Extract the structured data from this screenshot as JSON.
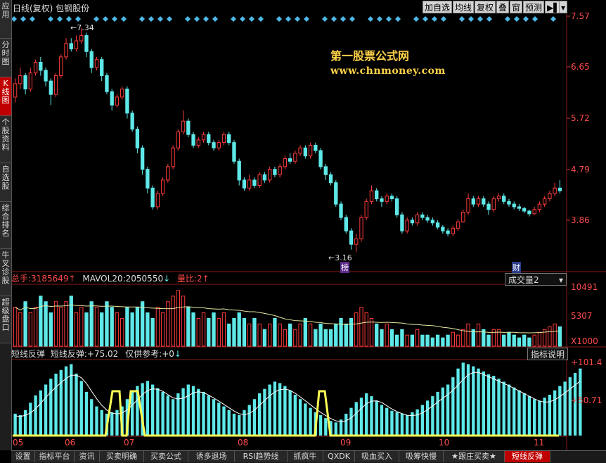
{
  "header": {
    "title": "日线(复权)  包钢股份",
    "toolbar": [
      "加自选",
      "均线",
      "复权",
      "叠",
      "窗",
      "预测",
      "▶▌",
      "▾"
    ]
  },
  "sidebar": {
    "items": [
      {
        "label": "应用",
        "active": false
      },
      {
        "label": "分时图",
        "active": false
      },
      {
        "label": "K线图",
        "active": true
      },
      {
        "label": "个股资料",
        "active": false
      },
      {
        "label": "自选股",
        "active": false
      },
      {
        "label": "综合排名",
        "active": false
      },
      {
        "label": "牛叉诊股",
        "active": false
      },
      {
        "label": "超级盘口",
        "active": false
      }
    ]
  },
  "watermark": {
    "line1": "第一股票公式网",
    "line2": "www.chnmoney.com"
  },
  "price_chart": {
    "axis_labels": [
      "7.57",
      "6.65",
      "5.72",
      "4.79",
      "3.86"
    ],
    "high_label": "7.34",
    "low_label": "3.16",
    "marker_bang": "榜",
    "marker_cai": "财"
  },
  "volume_panel": {
    "total_label": "总手:",
    "total_value": "3185649",
    "mavol_label": "MAVOL20:",
    "mavol_value": "2050550",
    "ratio_label": "量比:",
    "ratio_value": "2",
    "dropdown_label": "成交量2",
    "axis_labels": [
      "10491",
      "5307",
      "X1000"
    ]
  },
  "indicator_panel": {
    "name": "短线反弹",
    "series_label": "短线反弹:",
    "series_value": "+75.02",
    "ref_label": "仅供参考:",
    "ref_value": "+0",
    "explain_button": "指标说明",
    "axis_labels": [
      "+101.4",
      "+50.71"
    ]
  },
  "months": [
    "05",
    "06",
    "07",
    "08",
    "09",
    "10",
    "11"
  ],
  "bottom_tabs": [
    {
      "label": "设置",
      "active": false
    },
    {
      "label": "指标平台",
      "active": false
    },
    {
      "label": "资讯",
      "active": false
    },
    {
      "label": "买卖明确",
      "active": false
    },
    {
      "label": "买卖公式",
      "active": false
    },
    {
      "label": "诱多退场",
      "active": false
    },
    {
      "label": "RSI趋势线",
      "active": false
    },
    {
      "label": "抓疯牛",
      "active": false
    },
    {
      "label": "QXDK",
      "active": false
    },
    {
      "label": "吸血买入",
      "active": false
    },
    {
      "label": "吸筹快慢",
      "active": false
    },
    {
      "label": "★跟庄买卖★",
      "active": false
    },
    {
      "label": "短线反弹",
      "active": true
    }
  ],
  "colors": {
    "up": "#ff3b3b",
    "down": "#5ee8e8",
    "ma": "#e8e8a0",
    "signal": "#ffff55",
    "background": "#000000"
  },
  "chart_data": {
    "type": "candlestick",
    "ylim": [
      3.0,
      7.6
    ],
    "candles": [
      [
        6.05,
        6.3,
        6.4,
        5.95
      ],
      [
        6.3,
        6.45,
        6.6,
        6.2
      ],
      [
        6.45,
        6.2,
        6.5,
        6.1
      ],
      [
        6.2,
        6.5,
        6.6,
        6.15
      ],
      [
        6.5,
        6.7,
        6.75,
        6.45
      ],
      [
        6.7,
        6.55,
        6.8,
        6.45
      ],
      [
        6.55,
        6.35,
        6.6,
        6.25
      ],
      [
        6.35,
        6.1,
        6.4,
        5.9
      ],
      [
        6.1,
        6.45,
        6.5,
        6.05
      ],
      [
        6.45,
        6.8,
        6.85,
        6.4
      ],
      [
        6.8,
        7.05,
        7.15,
        6.75
      ],
      [
        7.05,
        6.95,
        7.15,
        6.9
      ],
      [
        6.95,
        7.1,
        7.2,
        6.9
      ],
      [
        7.1,
        7.2,
        7.34,
        7.05
      ],
      [
        7.2,
        6.9,
        7.25,
        6.8
      ],
      [
        6.9,
        6.6,
        6.95,
        6.5
      ],
      [
        6.6,
        6.75,
        6.8,
        6.55
      ],
      [
        6.75,
        6.45,
        6.8,
        6.35
      ],
      [
        6.45,
        6.15,
        6.5,
        6.1
      ],
      [
        6.15,
        5.9,
        6.2,
        5.8
      ],
      [
        5.9,
        6.05,
        6.1,
        5.85
      ],
      [
        6.05,
        6.2,
        6.25,
        6.0
      ],
      [
        6.2,
        5.75,
        6.25,
        5.65
      ],
      [
        5.75,
        5.45,
        5.8,
        5.4
      ],
      [
        5.45,
        5.1,
        5.5,
        5.0
      ],
      [
        5.1,
        4.7,
        5.15,
        4.6
      ],
      [
        4.7,
        4.35,
        4.75,
        4.25
      ],
      [
        4.35,
        4.0,
        4.4,
        3.95
      ],
      [
        4.0,
        4.25,
        4.3,
        3.95
      ],
      [
        4.25,
        4.5,
        4.55,
        4.2
      ],
      [
        4.5,
        4.75,
        4.8,
        4.45
      ],
      [
        4.75,
        5.1,
        5.15,
        4.7
      ],
      [
        5.1,
        5.4,
        5.45,
        5.05
      ],
      [
        5.4,
        5.6,
        5.8,
        5.35
      ],
      [
        5.6,
        5.35,
        5.65,
        5.3
      ],
      [
        5.35,
        5.15,
        5.4,
        5.1
      ],
      [
        5.15,
        5.25,
        5.3,
        5.1
      ],
      [
        5.25,
        5.35,
        5.4,
        5.2
      ],
      [
        5.35,
        5.2,
        5.4,
        5.15
      ],
      [
        5.2,
        5.1,
        5.25,
        5.05
      ],
      [
        5.1,
        5.2,
        5.25,
        5.05
      ],
      [
        5.2,
        5.35,
        5.4,
        5.15
      ],
      [
        5.35,
        5.2,
        5.4,
        5.15
      ],
      [
        5.2,
        4.85,
        5.25,
        4.8
      ],
      [
        4.85,
        4.5,
        4.9,
        4.4
      ],
      [
        4.5,
        4.35,
        4.55,
        4.3
      ],
      [
        4.35,
        4.5,
        4.6,
        4.3
      ],
      [
        4.5,
        4.4,
        4.55,
        4.35
      ],
      [
        4.4,
        4.6,
        4.65,
        4.35
      ],
      [
        4.6,
        4.5,
        4.65,
        4.45
      ],
      [
        4.5,
        4.7,
        4.75,
        4.45
      ],
      [
        4.7,
        4.6,
        4.75,
        4.55
      ],
      [
        4.6,
        4.75,
        4.8,
        4.55
      ],
      [
        4.75,
        4.9,
        4.95,
        4.7
      ],
      [
        4.9,
        4.85,
        5.0,
        4.8
      ],
      [
        4.85,
        5.0,
        5.05,
        4.8
      ],
      [
        5.0,
        5.1,
        5.15,
        4.95
      ],
      [
        5.1,
        4.95,
        5.15,
        4.9
      ],
      [
        4.95,
        5.15,
        5.2,
        4.9
      ],
      [
        5.15,
        5.05,
        5.2,
        5.0
      ],
      [
        5.05,
        4.75,
        5.1,
        4.7
      ],
      [
        4.75,
        4.6,
        4.8,
        4.5
      ],
      [
        4.6,
        4.45,
        4.65,
        4.4
      ],
      [
        4.45,
        4.05,
        4.5,
        4.0
      ],
      [
        4.05,
        3.8,
        4.1,
        3.75
      ],
      [
        3.8,
        3.55,
        3.85,
        3.5
      ],
      [
        3.55,
        3.3,
        3.6,
        3.2
      ],
      [
        3.3,
        3.4,
        3.5,
        3.16
      ],
      [
        3.4,
        3.8,
        3.85,
        3.35
      ],
      [
        3.8,
        4.1,
        4.15,
        3.75
      ],
      [
        4.1,
        4.3,
        4.4,
        4.05
      ],
      [
        4.3,
        4.15,
        4.35,
        4.1
      ],
      [
        4.15,
        4.1,
        4.2,
        4.0
      ],
      [
        4.1,
        4.2,
        4.25,
        4.05
      ],
      [
        4.2,
        4.15,
        4.25,
        4.1
      ],
      [
        4.15,
        3.85,
        4.2,
        3.8
      ],
      [
        3.85,
        3.55,
        3.9,
        3.5
      ],
      [
        3.55,
        3.75,
        3.8,
        3.5
      ],
      [
        3.75,
        3.7,
        3.8,
        3.65
      ],
      [
        3.7,
        3.85,
        3.9,
        3.65
      ],
      [
        3.85,
        3.8,
        3.9,
        3.75
      ],
      [
        3.8,
        3.75,
        3.85,
        3.7
      ],
      [
        3.75,
        3.7,
        3.8,
        3.65
      ],
      [
        3.7,
        3.62,
        3.75,
        3.58
      ],
      [
        3.62,
        3.55,
        3.66,
        3.5
      ],
      [
        3.55,
        3.5,
        3.6,
        3.45
      ],
      [
        3.5,
        3.6,
        3.65,
        3.45
      ],
      [
        3.6,
        3.72,
        3.77,
        3.55
      ],
      [
        3.72,
        3.9,
        3.95,
        3.7
      ],
      [
        3.9,
        4.15,
        4.25,
        3.85
      ],
      [
        4.15,
        4.05,
        4.2,
        4.0
      ],
      [
        4.05,
        4.15,
        4.2,
        4.0
      ],
      [
        4.15,
        4.05,
        4.2,
        4.0
      ],
      [
        4.05,
        3.95,
        4.1,
        3.85
      ],
      [
        3.95,
        4.15,
        4.2,
        3.9
      ],
      [
        4.15,
        4.2,
        4.25,
        4.1
      ],
      [
        4.2,
        4.1,
        4.25,
        4.05
      ],
      [
        4.1,
        4.05,
        4.15,
        4.0
      ],
      [
        4.05,
        4.0,
        4.1,
        3.95
      ],
      [
        4.0,
        3.97,
        4.05,
        3.92
      ],
      [
        3.97,
        3.92,
        4.0,
        3.88
      ],
      [
        3.92,
        3.87,
        3.95,
        3.82
      ],
      [
        3.87,
        3.95,
        4.0,
        3.85
      ],
      [
        3.95,
        4.05,
        4.1,
        3.9
      ],
      [
        4.05,
        4.15,
        4.2,
        4.0
      ],
      [
        4.15,
        4.25,
        4.3,
        4.1
      ],
      [
        4.25,
        4.35,
        4.45,
        4.2
      ],
      [
        4.35,
        4.3,
        4.5,
        4.25
      ]
    ],
    "volume": [
      7,
      6,
      8,
      6,
      7,
      9,
      8,
      6,
      8,
      7,
      8,
      9,
      6,
      7,
      6,
      8,
      7,
      6,
      8,
      7,
      6,
      5,
      7,
      6,
      7,
      8,
      6,
      5,
      7,
      6,
      8,
      9,
      10,
      9,
      7,
      6,
      5,
      6,
      5,
      6,
      5,
      6,
      4,
      5,
      6,
      5,
      4,
      5,
      4,
      3,
      4,
      5,
      4,
      3,
      4,
      3,
      4,
      5,
      4,
      3,
      4,
      3,
      3,
      4,
      5,
      4,
      5,
      6,
      7,
      6,
      5,
      4,
      3,
      4,
      3,
      2,
      3,
      2,
      2,
      3,
      2,
      2,
      1.5,
      2,
      1.5,
      2,
      2.5,
      2,
      3,
      4,
      3,
      4,
      3,
      2,
      3,
      3,
      2,
      2.5,
      2,
      1.5,
      2,
      1.5,
      2,
      2.5,
      3,
      3.5,
      4,
      3.5
    ],
    "indicator": [
      30,
      28,
      35,
      45,
      55,
      62,
      70,
      78,
      85,
      90,
      95,
      98,
      85,
      75,
      60,
      50,
      40,
      35,
      30,
      32,
      35,
      40,
      50,
      60,
      68,
      72,
      75,
      70,
      65,
      60,
      55,
      50,
      58,
      65,
      70,
      68,
      64,
      60,
      55,
      50,
      45,
      40,
      35,
      30,
      28,
      35,
      42,
      50,
      58,
      64,
      70,
      74,
      72,
      68,
      62,
      56,
      50,
      44,
      38,
      32,
      28,
      24,
      20,
      18,
      22,
      30,
      38,
      46,
      52,
      58,
      54,
      48,
      42,
      38,
      34,
      32,
      30,
      28,
      32,
      36,
      42,
      48,
      54,
      60,
      66,
      70,
      80,
      92,
      100,
      98,
      95,
      92,
      88,
      84,
      82,
      78,
      74,
      70,
      66,
      62,
      58,
      54,
      50,
      48,
      52,
      56,
      62,
      68,
      74,
      80,
      86,
      92
    ]
  }
}
